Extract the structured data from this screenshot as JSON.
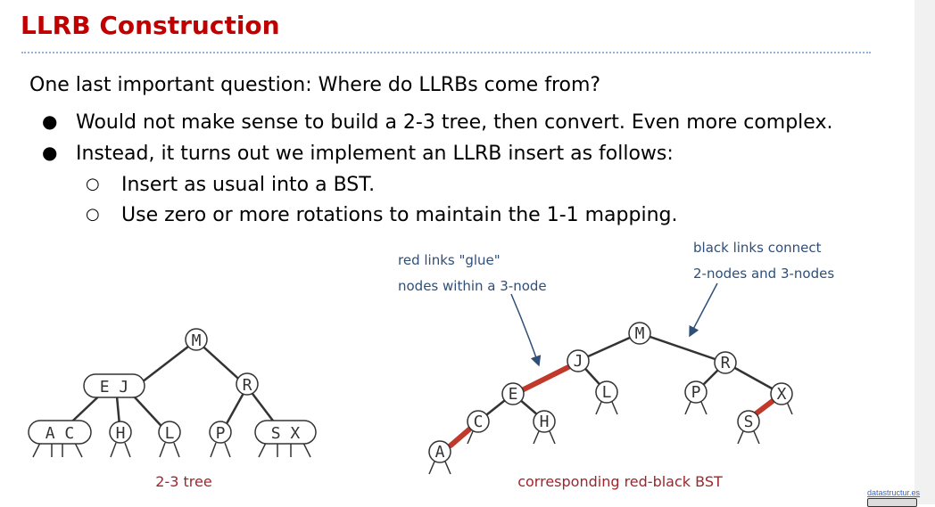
{
  "slide": {
    "title": "LLRB Construction",
    "intro": "One last important question: Where do LLRBs come from?",
    "bullets": [
      "Would not make sense to build a 2-3 tree, then convert. Even more complex.",
      "Instead, it turns out we implement an LLRB insert as follows:"
    ],
    "sub_bullets": [
      "Insert as usual into a BST.",
      "Use zero or more rotations to maintain the 1-1 mapping."
    ],
    "bullet_mark": "●",
    "sub_bullet_mark": "○"
  },
  "tree23": {
    "caption": "2-3 tree",
    "nodes": {
      "root": "M",
      "ej": "E J",
      "r": "R",
      "ac": "A C",
      "h": "H",
      "l": "L",
      "p": "P",
      "sx": "S X"
    }
  },
  "rbtree": {
    "caption": "corresponding red-black BST",
    "annotation_red_line1": "red links \"glue\"",
    "annotation_red_line2": "nodes within a 3-node",
    "annotation_black_line1": "black links connect",
    "annotation_black_line2": "2-nodes and 3-nodes",
    "nodes": {
      "m": "M",
      "j": "J",
      "r": "R",
      "e": "E",
      "l": "L",
      "p": "P",
      "x": "X",
      "c": "C",
      "h": "H",
      "s": "S",
      "a": "A"
    },
    "colors": {
      "red_link": "#c0392b",
      "black_link": "#333333",
      "arrow": "#2f4f78"
    }
  },
  "footer": {
    "link_text": "datastructur.es"
  }
}
